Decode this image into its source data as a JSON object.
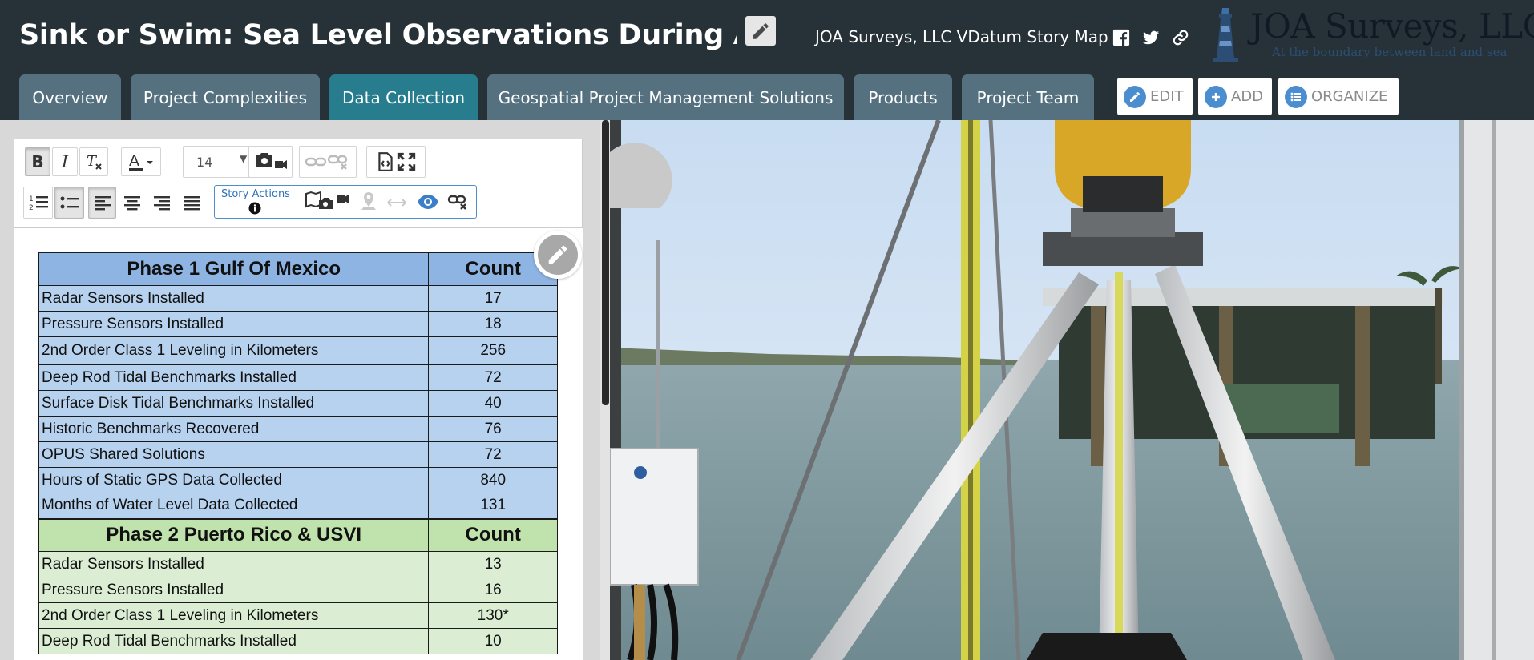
{
  "header": {
    "title": "Sink or Swim: Sea Level Observations During A Pandemic",
    "subtitle": "JOA Surveys, LLC VDatum Story Map",
    "social": [
      "facebook-icon",
      "twitter-icon",
      "link-icon"
    ],
    "logo_name": "JOA Surveys, LLC",
    "logo_tagline": "At the boundary between land and sea"
  },
  "tabs": [
    {
      "label": "Overview",
      "active": false
    },
    {
      "label": "Project Complexities",
      "active": false
    },
    {
      "label": "Data Collection",
      "active": true
    },
    {
      "label": "Geospatial Project Management Solutions",
      "active": false
    },
    {
      "label": "Products",
      "active": false
    },
    {
      "label": "Project Team",
      "active": false
    }
  ],
  "builder_buttons": {
    "edit": "EDIT",
    "add": "ADD",
    "organize": "ORGANIZE"
  },
  "editor": {
    "font_size": "14",
    "story_actions_label": "Story Actions"
  },
  "colors": {
    "header_bg": "#263238",
    "tab_bg": "#55707f",
    "tab_active_bg": "#277d8e",
    "accent_blue": "#4a8ed0",
    "phase1_header": "#8eb4e3",
    "phase1_row": "#b7d2ef",
    "phase2_header": "#c0e3ad",
    "phase2_row": "#dbeed4"
  },
  "table": {
    "phase1": {
      "header": "Phase 1 Gulf Of Mexico",
      "count_header": "Count",
      "rows": [
        {
          "label": "Radar Sensors Installed",
          "count": "17"
        },
        {
          "label": "Pressure Sensors Installed",
          "count": "18"
        },
        {
          "label": "2nd Order Class 1 Leveling in Kilometers",
          "count": "256"
        },
        {
          "label": "Deep Rod Tidal Benchmarks Installed",
          "count": "72"
        },
        {
          "label": "Surface Disk Tidal Benchmarks Installed",
          "count": "40"
        },
        {
          "label": "Historic Benchmarks Recovered",
          "count": "76"
        },
        {
          "label": "OPUS Shared Solutions",
          "count": "72"
        },
        {
          "label": "Hours of Static GPS Data Collected",
          "count": "840"
        },
        {
          "label": "Months of Water Level Data Collected",
          "count": "131"
        }
      ]
    },
    "phase2": {
      "header": "Phase 2 Puerto Rico & USVI",
      "count_header": "Count",
      "rows": [
        {
          "label": "Radar Sensors Installed",
          "count": "13"
        },
        {
          "label": "Pressure Sensors Installed",
          "count": "16"
        },
        {
          "label": "2nd Order Class 1 Leveling in Kilometers",
          "count": "130*"
        },
        {
          "label": "Deep Rod Tidal Benchmarks Installed",
          "count": "10"
        }
      ]
    }
  }
}
